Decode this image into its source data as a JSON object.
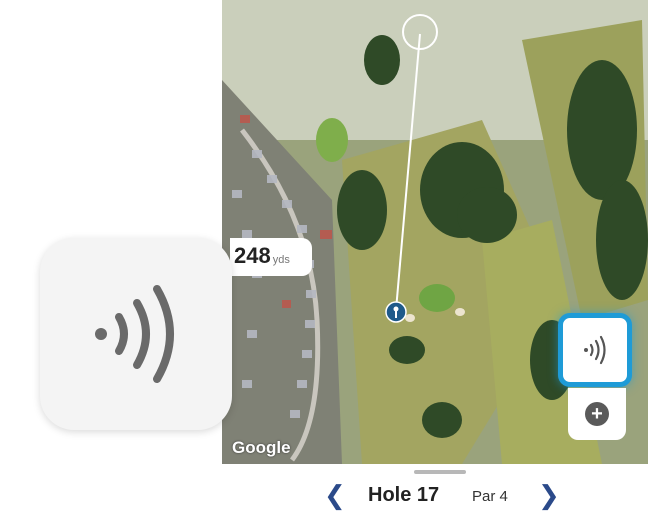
{
  "map": {
    "distance_value": "248",
    "distance_unit": "yds",
    "attribution": "Google"
  },
  "icons": {
    "rangefinder": "rangefinder-signal-icon",
    "add": "plus-icon",
    "tee": "tee-marker-icon",
    "target": "target-circle-icon"
  },
  "hole_nav": {
    "prev_symbol": "❮",
    "next_symbol": "❯",
    "hole_label": "Hole 17",
    "par_label": "Par 4"
  },
  "controls": {
    "add_symbol": "+"
  },
  "colors": {
    "accent": "#1e9bd7",
    "nav_arrow": "#2b4a8a",
    "tee_marker": "#1f5a8a"
  }
}
